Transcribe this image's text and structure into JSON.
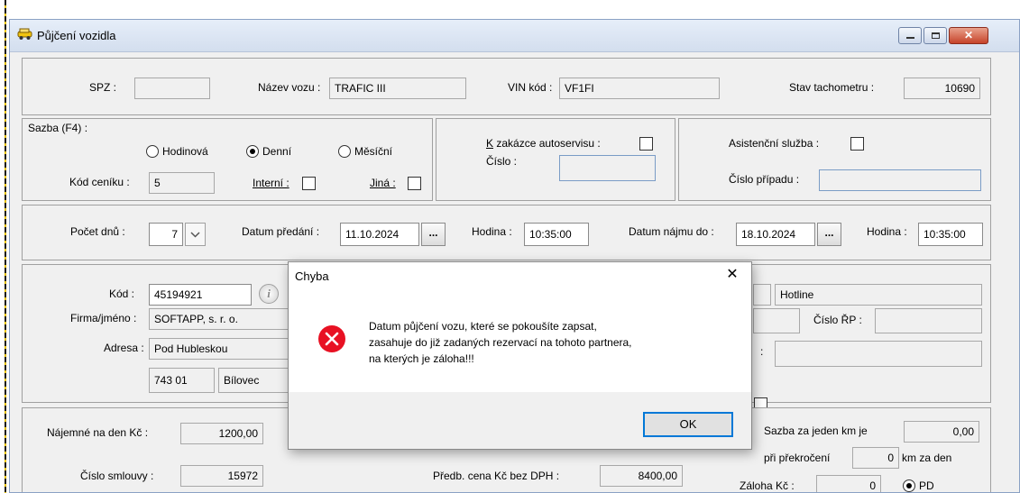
{
  "window": {
    "title": "Půjčení vozidla"
  },
  "vehicle": {
    "spz_label": "SPZ :",
    "spz_value": "",
    "model_label": "Název vozu :",
    "model_value": "TRAFIC III",
    "vin_label": "VIN kód :",
    "vin_value": "VF1FI",
    "odometer_label": "Stav tachometru :",
    "odometer_value": "10690"
  },
  "rate": {
    "title": "Sazba (F4) :",
    "hourly": "Hodinová",
    "daily": "Denní",
    "monthly": "Měsíční",
    "selected": "Denní",
    "pricelist_label": "Kód ceníku :",
    "pricelist_value": "5",
    "internal_label": "Interní :",
    "other_label": "Jiná :"
  },
  "service": {
    "order_prefix": "K",
    "order_label": " zakázce autoservisu :",
    "number_label": "Číslo :",
    "number_value": ""
  },
  "assistance": {
    "label": "Asistenční služba :",
    "case_label": "Číslo případu :",
    "case_value": ""
  },
  "dates": {
    "days_label": "Počet dnů :",
    "days_value": "7",
    "handover_label": "Datum předání :",
    "handover_value": "11.10.2024",
    "hour_label": "Hodina :",
    "handover_hour": "10:35:00",
    "lease_until_label": "Datum nájmu do :",
    "lease_until_value": "18.10.2024",
    "lease_hour": "10:35:00",
    "dots": "..."
  },
  "partner": {
    "code_label": "Kód :",
    "code_value": "45194921",
    "company_label": "Firma/jméno :",
    "company_value": "SOFTAPP, s. r. o.",
    "address_label": "Adresa :",
    "street": "Pod Hubleskou",
    "zip": "743 01",
    "city": "Bílovec",
    "hotline": "Hotline",
    "rp_label": "Číslo ŘP :",
    "rp_value": ""
  },
  "pricing": {
    "rent_label": "Nájemné na den Kč :",
    "rent_value": "1200,00",
    "contract_label": "Číslo smlouvy :",
    "contract_value": "15972",
    "estimate_label": "Předb. cena Kč bez DPH :",
    "estimate_value": "8400,00",
    "km_rate_label": "Sazba za jeden km je",
    "km_rate_value": "0,00",
    "exceed_label": "při překročení",
    "exceed_value": "0",
    "km_per_day": "km za den",
    "deposit_label": "Záloha Kč :",
    "deposit_value": "0",
    "deposit_option": "PD"
  },
  "dialog": {
    "title": "Chyba",
    "line1": "Datum půjčení vozu, které se pokoušíte zapsat,",
    "line2": "zasahuje do již zadaných rezervací na tohoto partnera,",
    "line3": "na kterých je záloha!!!",
    "ok": "OK",
    "close": "✕"
  },
  "colors": {
    "accent": "#0078d7",
    "error": "#e81123"
  }
}
